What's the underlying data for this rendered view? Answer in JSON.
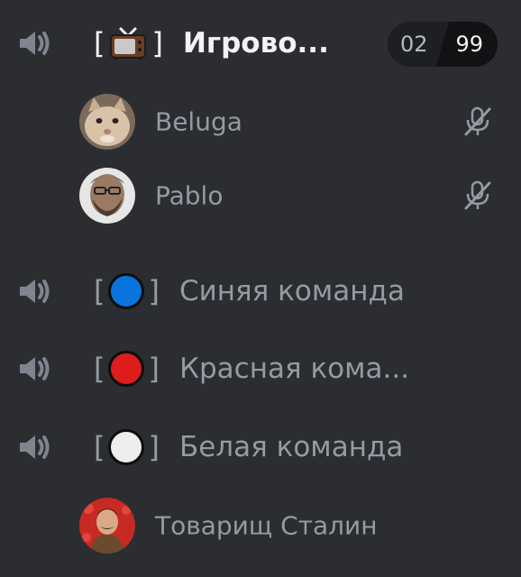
{
  "channels": [
    {
      "name": "Игрово...",
      "marker": "tv-icon",
      "active": true,
      "limit": {
        "current": "02",
        "max": "99"
      }
    },
    {
      "name": "Синяя команда",
      "marker": "blue-circle",
      "color": "#0a74de"
    },
    {
      "name": "Красная кома...",
      "marker": "red-circle",
      "color": "#dd1c1c"
    },
    {
      "name": "Белая команда",
      "marker": "white-circle",
      "color": "#eeeeee"
    }
  ],
  "bracket_open": "[",
  "bracket_close": "]",
  "users": [
    {
      "name": "Beluga",
      "channel": 0,
      "muted": true,
      "avatar": "beluga-cat-avatar"
    },
    {
      "name": "Pablo",
      "channel": 0,
      "muted": true,
      "avatar": "bearded-man-avatar"
    },
    {
      "name": "Товарищ Сталин",
      "channel": 3,
      "muted": false,
      "avatar": "portrait-avatar"
    }
  ],
  "colors": {
    "background": "#2b2d31",
    "muted_text": "#949ba4",
    "active_text": "#f2f3f5"
  }
}
